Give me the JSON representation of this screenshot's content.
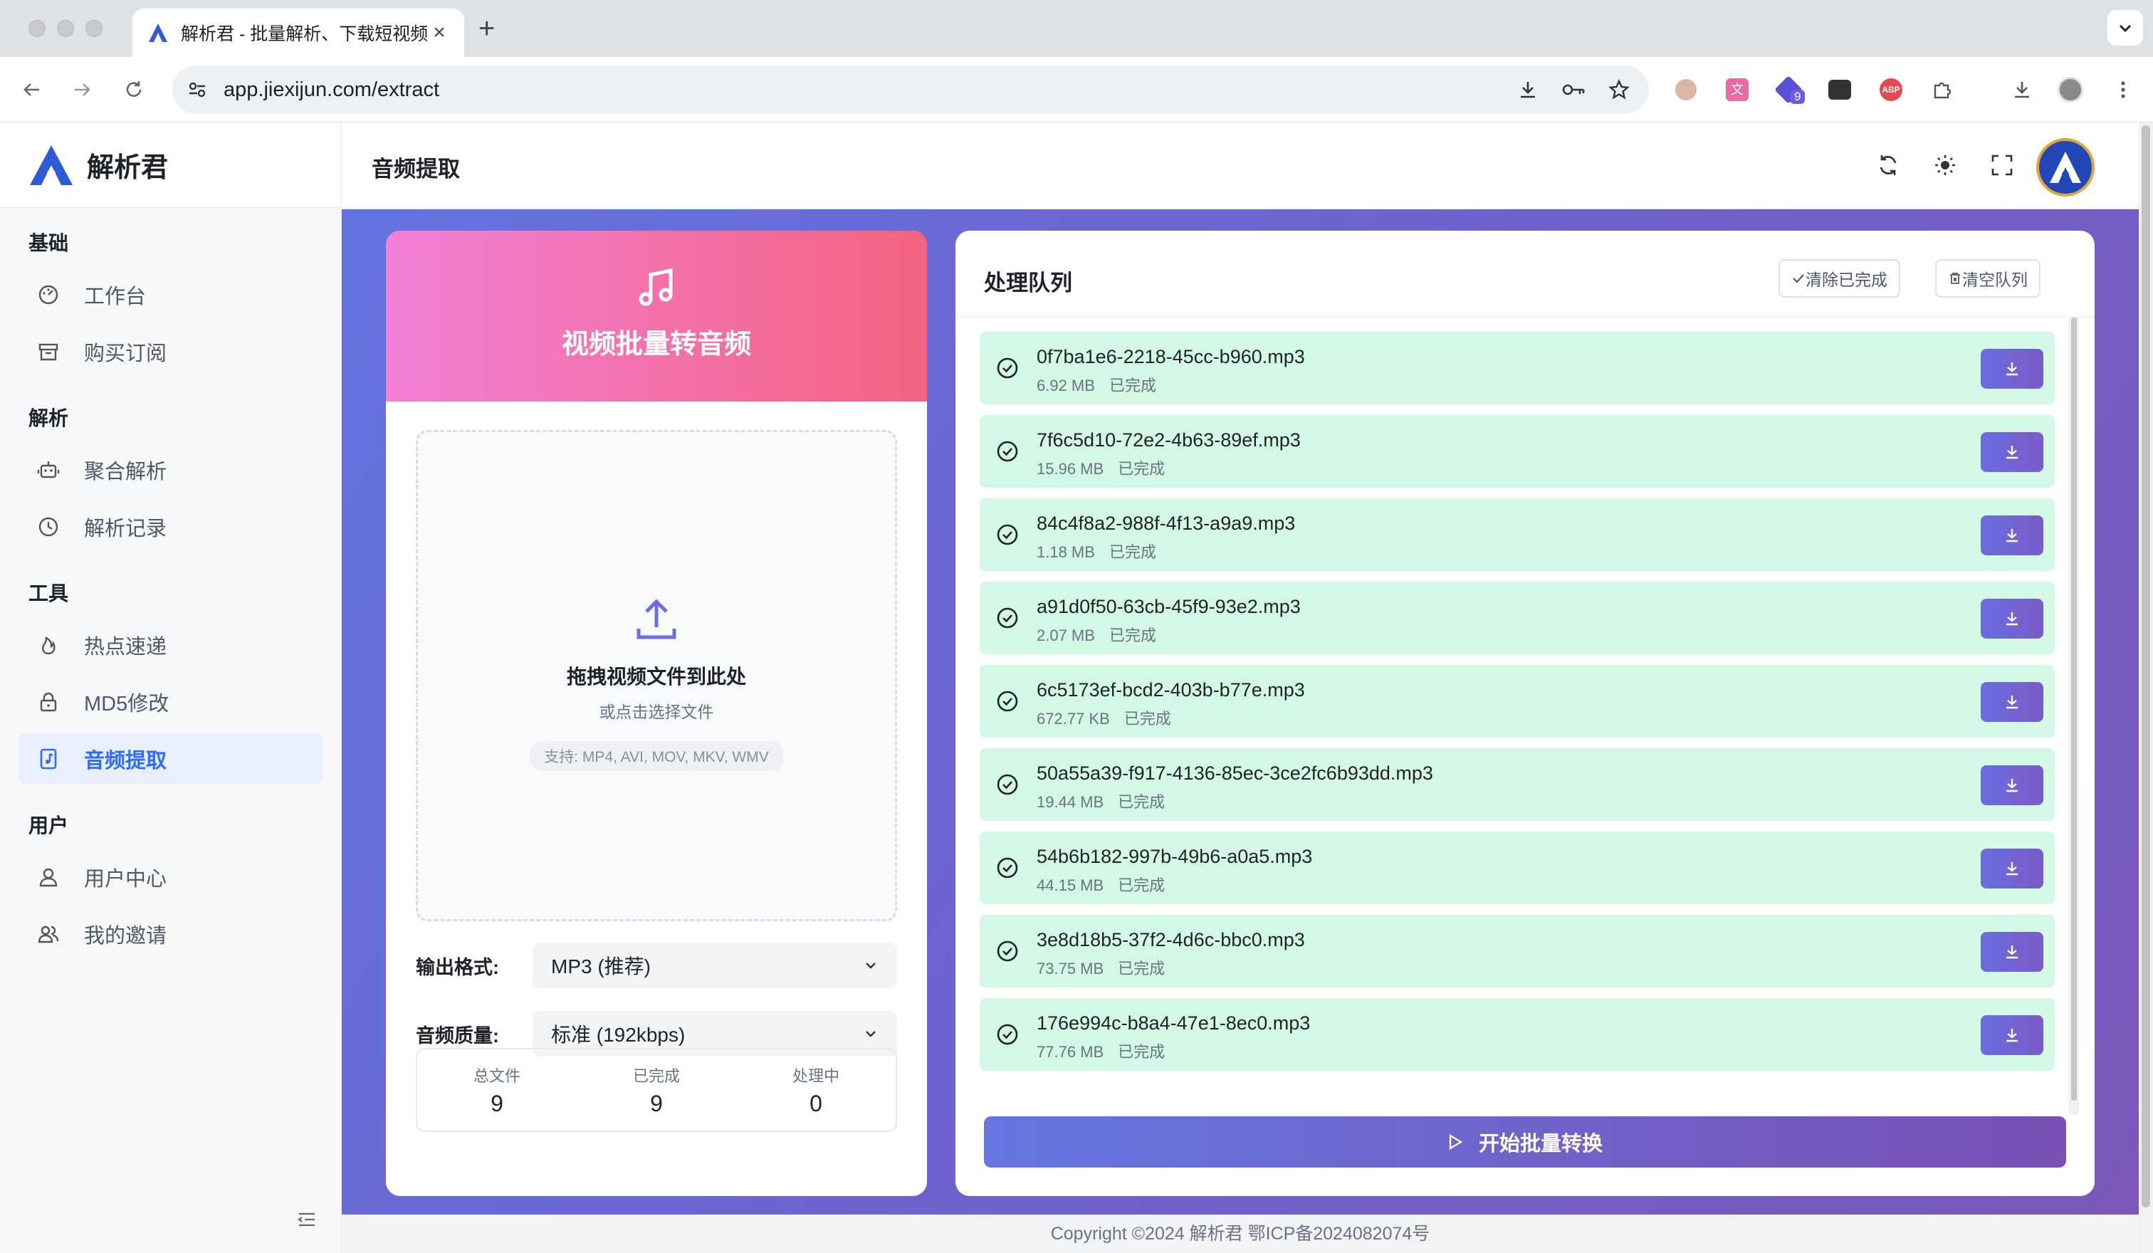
{
  "browser": {
    "tab_title": "解析君 - 批量解析、下载短视频",
    "url": "app.jiexijun.com/extract",
    "extension_badge": "9"
  },
  "sidebar": {
    "brand": "解析君",
    "groups": [
      {
        "title": "基础",
        "items": [
          {
            "label": "工作台",
            "icon": "dashboard-icon"
          },
          {
            "label": "购买订阅",
            "icon": "archive-icon"
          }
        ]
      },
      {
        "title": "解析",
        "items": [
          {
            "label": "聚合解析",
            "icon": "robot-icon"
          },
          {
            "label": "解析记录",
            "icon": "history-icon"
          }
        ]
      },
      {
        "title": "工具",
        "items": [
          {
            "label": "热点速递",
            "icon": "fire-icon"
          },
          {
            "label": "MD5修改",
            "icon": "lock-icon"
          },
          {
            "label": "音频提取",
            "icon": "music-file-icon",
            "active": true
          }
        ]
      },
      {
        "title": "用户",
        "items": [
          {
            "label": "用户中心",
            "icon": "user-icon"
          },
          {
            "label": "我的邀请",
            "icon": "users-icon"
          }
        ]
      }
    ]
  },
  "header": {
    "title": "音频提取"
  },
  "converter": {
    "title": "视频批量转音频",
    "drop_main": "拖拽视频文件到此处",
    "drop_sub": "或点击选择文件",
    "drop_formats": "支持: MP4, AVI, MOV, MKV, WMV",
    "format_label": "输出格式:",
    "format_value": "MP3 (推荐)",
    "quality_label": "音频质量:",
    "quality_value": "标准 (192kbps)",
    "stats": [
      {
        "label": "总文件",
        "value": "9"
      },
      {
        "label": "已完成",
        "value": "9"
      },
      {
        "label": "处理中",
        "value": "0"
      }
    ]
  },
  "queue": {
    "title": "处理队列",
    "clear_done_label": "清除已完成",
    "clear_all_label": "清空队列",
    "start_label": "开始批量转换",
    "items": [
      {
        "name": "0f7ba1e6-2218-45cc-b960.mp3",
        "size": "6.92 MB",
        "status": "已完成"
      },
      {
        "name": "7f6c5d10-72e2-4b63-89ef.mp3",
        "size": "15.96 MB",
        "status": "已完成"
      },
      {
        "name": "84c4f8a2-988f-4f13-a9a9.mp3",
        "size": "1.18 MB",
        "status": "已完成"
      },
      {
        "name": "a91d0f50-63cb-45f9-93e2.mp3",
        "size": "2.07 MB",
        "status": "已完成"
      },
      {
        "name": "6c5173ef-bcd2-403b-b77e.mp3",
        "size": "672.77 KB",
        "status": "已完成"
      },
      {
        "name": "50a55a39-f917-4136-85ec-3ce2fc6b93dd.mp3",
        "size": "19.44 MB",
        "status": "已完成"
      },
      {
        "name": "54b6b182-997b-49b6-a0a5.mp3",
        "size": "44.15 MB",
        "status": "已完成"
      },
      {
        "name": "3e8d18b5-37f2-4d6c-bbc0.mp3",
        "size": "73.75 MB",
        "status": "已完成"
      },
      {
        "name": "176e994c-b8a4-47e1-8ec0.mp3",
        "size": "77.76 MB",
        "status": "已完成"
      }
    ]
  },
  "footer": {
    "text": "Copyright ©2024 解析君 鄂ICP备2024082074号"
  },
  "colors": {
    "accent": "#2f6bff",
    "queue_item_bg": "#d3f8e5",
    "button_gradient_start": "#6677e2",
    "button_gradient_end": "#7950b4"
  }
}
